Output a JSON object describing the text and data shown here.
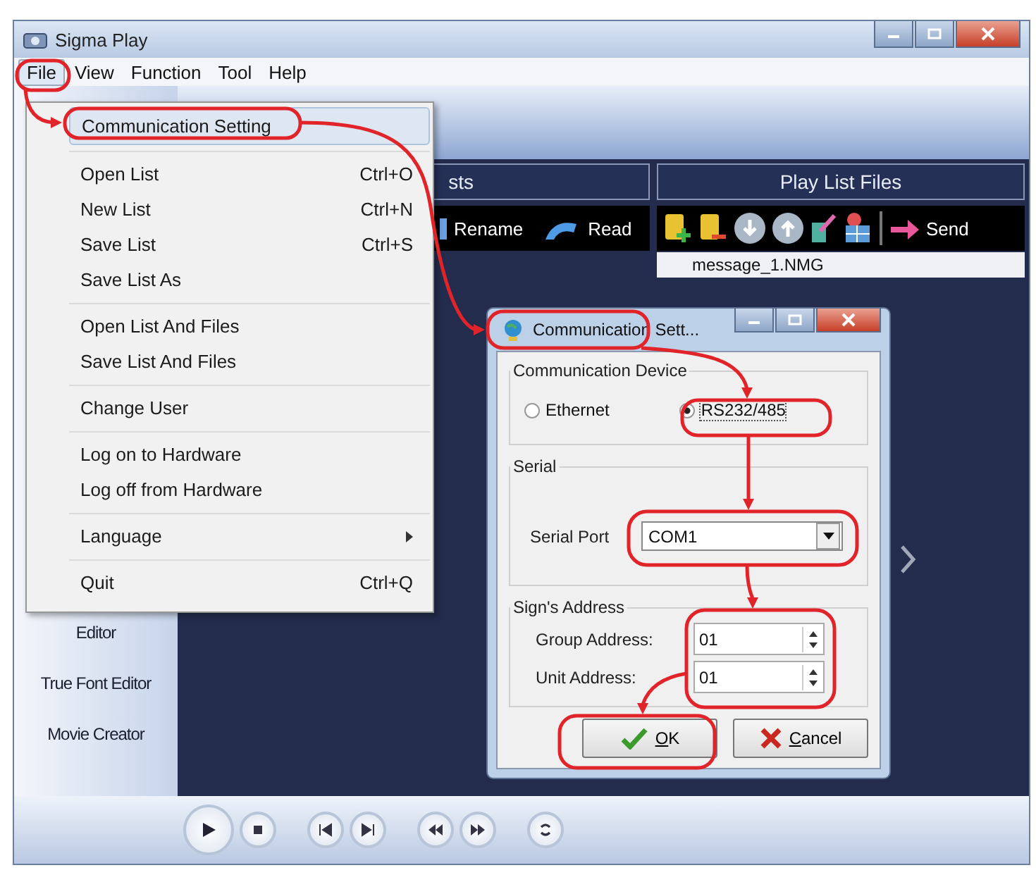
{
  "window": {
    "title": "Sigma Play"
  },
  "menubar": [
    {
      "label": "File",
      "selected": true
    },
    {
      "label": "View",
      "selected": false
    },
    {
      "label": "Function",
      "selected": false
    },
    {
      "label": "Tool",
      "selected": false
    },
    {
      "label": "Help",
      "selected": false
    }
  ],
  "file_menu": [
    {
      "kind": "item",
      "label": "Communication Setting",
      "highlighted": true
    },
    {
      "kind": "separator"
    },
    {
      "kind": "item",
      "label": "Open List",
      "shortcut": "Ctrl+O",
      "highlighted": false
    },
    {
      "kind": "item",
      "label": "New List",
      "shortcut": "Ctrl+N",
      "highlighted": false
    },
    {
      "kind": "item",
      "label": "Save List",
      "shortcut": "Ctrl+S",
      "highlighted": false
    },
    {
      "kind": "item",
      "label": "Save List As",
      "highlighted": false
    },
    {
      "kind": "separator"
    },
    {
      "kind": "item",
      "label": "Open List And Files",
      "highlighted": false
    },
    {
      "kind": "item",
      "label": "Save List And Files",
      "highlighted": false
    },
    {
      "kind": "separator"
    },
    {
      "kind": "item",
      "label": "Change User",
      "highlighted": false
    },
    {
      "kind": "separator"
    },
    {
      "kind": "item",
      "label": "Log on to Hardware",
      "highlighted": false
    },
    {
      "kind": "item",
      "label": "Log off from Hardware",
      "highlighted": false
    },
    {
      "kind": "separator"
    },
    {
      "kind": "submenu",
      "label": "Language",
      "highlighted": false
    },
    {
      "kind": "separator"
    },
    {
      "kind": "item",
      "label": "Quit",
      "shortcut": "Ctrl+Q",
      "highlighted": false
    }
  ],
  "sidebar": {
    "items": [
      "Editor",
      "True Font Editor",
      "Movie Creator"
    ]
  },
  "lists_panel": {
    "title": "sts",
    "toolbar": [
      {
        "kind": "rename",
        "label": "Rename"
      },
      {
        "kind": "read",
        "label": "Read"
      }
    ]
  },
  "files_panel": {
    "title": "Play List Files",
    "send_label": "Send",
    "files": [
      "message_1.NMG"
    ]
  },
  "dialog": {
    "title": "Communication Sett...",
    "device": {
      "label": "Communication Device",
      "options": [
        {
          "label": "Ethernet",
          "selected": false
        },
        {
          "label": "RS232/485",
          "selected": true
        }
      ]
    },
    "serial": {
      "label": "Serial",
      "port_label": "Serial Port",
      "port_value": "COM1"
    },
    "address": {
      "label": "Sign's Address",
      "fields": [
        {
          "label": "Group Address:",
          "value": "01"
        },
        {
          "label": "Unit Address:",
          "value": "01"
        }
      ]
    },
    "buttons": [
      {
        "kind": "ok",
        "label": "OK"
      },
      {
        "kind": "cancel",
        "label": "Cancel"
      }
    ]
  }
}
